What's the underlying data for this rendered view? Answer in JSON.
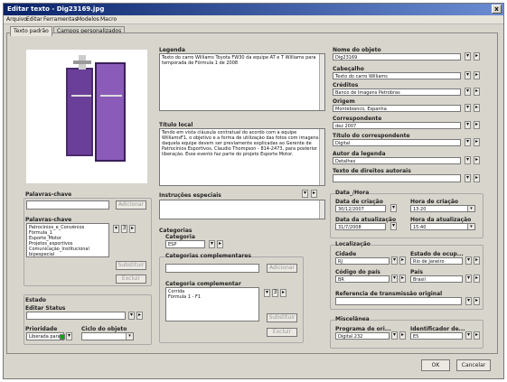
{
  "window": {
    "title": "Editar texto - Dig23169.jpg",
    "close_label": "x"
  },
  "menu": [
    "Arquivo",
    "Editar",
    "Ferramentas",
    "Modelos",
    "Macro"
  ],
  "tabs": [
    "Texto padrão",
    "Campos personalizados"
  ],
  "legenda": {
    "label": "Legenda",
    "value": "Texto do carro Williams Toyota FW30 da equipe AT e T Williams para temporada de Fórmula 1 de 2008"
  },
  "titulo_local": {
    "label": "Título local",
    "value": "Tendo em vista cláusula contratual do acordo com a equipe WilliamsF1, o objetivo e a forma de utilização das fotos com imagens daquela equipe devem ser previamente explicadas ao Gerente de Patrocínios Esportivos, Claudio Thompson - 814-2473, para posterior liberação. Esse evento faz parte do projeto Esporte Motor."
  },
  "instrucoes": {
    "label": "Instruções especiais",
    "value": ""
  },
  "palavras": {
    "label": "Palavras-chave",
    "label2": "Palavras-chave",
    "add": "Adicionar",
    "replace": "Substituir",
    "delete": "Excluir",
    "items": [
      "Patrocínios_e_Convênios",
      "Fórmula_1",
      "Esporte_Motor",
      "Projetos_esportivos",
      "Comunicação_Institucional",
      "bipespecial"
    ]
  },
  "estado": {
    "group": "Estado",
    "status_label": "Editar Status",
    "prioridade_label": "Prioridade",
    "prioridade_value": "Liberada para",
    "ciclo_label": "Ciclo do objeto"
  },
  "categorias": {
    "label": "Categorias",
    "categoria_label": "Categoria",
    "categoria_value": "ESP",
    "comp_label": "Categorias complementares",
    "add": "Adicionar",
    "comp2_label": "Categoria complementar",
    "items": [
      "Corrida",
      "Fórmula 1 - F1"
    ],
    "replace": "Substituir",
    "delete": "Excluir",
    "num": "3"
  },
  "right": {
    "nome": {
      "label": "Nome do objeto",
      "value": "Dig23169"
    },
    "cabecalho": {
      "label": "Cabeçalho",
      "value": "Texto do carro Williams"
    },
    "creditos": {
      "label": "Créditos",
      "value": "Banco de Imagens Petrobras"
    },
    "origem": {
      "label": "Origem",
      "value": "Montebianco, Espanha"
    },
    "correspondente": {
      "label": "Correspondente",
      "value": "dez 2007"
    },
    "titulo_corr": {
      "label": "Título do correspondente",
      "value": "Digital"
    },
    "autor": {
      "label": "Autor da legenda",
      "value": "Detalhes"
    },
    "direitos": {
      "label": "Texto de direitos autorais",
      "value": ""
    }
  },
  "datahora": {
    "group": "Data_/Hora",
    "dc_label": "Data de criação",
    "dc_value": "30/12/2007",
    "hc_label": "Hora de criação",
    "hc_value": "13:20",
    "da_label": "Data da atualização",
    "da_value": "31/7/2008",
    "ha_label": "Hora da atualização",
    "ha_value": "15:40"
  },
  "localizacao": {
    "group": "Localização",
    "cidade_label": "Cidade",
    "cidade_value": "RJ",
    "estado_label": "Estado de ocup...",
    "estado_value": "Rio de Janeiro",
    "codpais_label": "Código do país",
    "codpais_value": "BR",
    "pais_label": "País",
    "pais_value": "Brasil",
    "ref_label": "Referencia de transmissão original",
    "ref_value": ""
  },
  "misc": {
    "group": "Miscelânea",
    "prog_label": "Programa de ori...",
    "prog_value": "Digital 232",
    "ident_label": "Identificador de...",
    "ident_value": "E5"
  },
  "footer": {
    "ok": "OK",
    "cancel": "Cancelar"
  },
  "colors": {
    "titlebar": "#0a246a",
    "dialog": "#d8d5cc",
    "field": "#ffffff"
  }
}
